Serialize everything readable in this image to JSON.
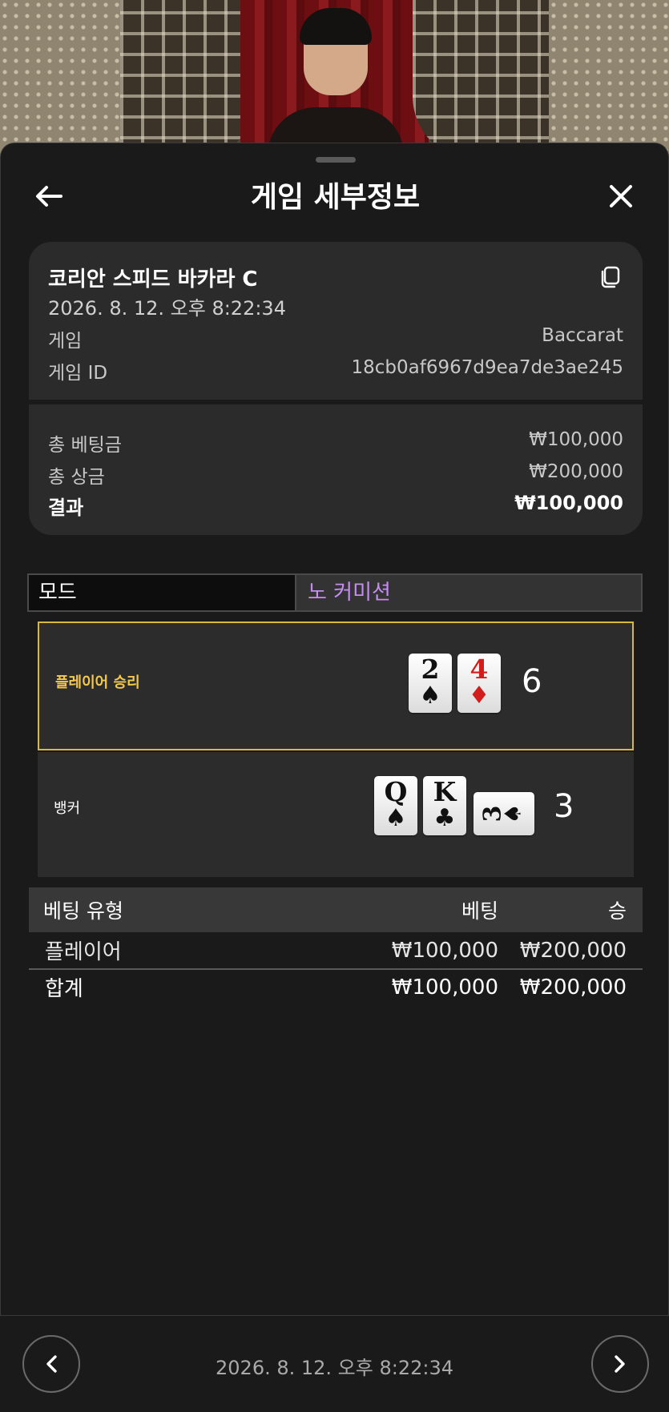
{
  "header": {
    "title": "게임 세부정보"
  },
  "game": {
    "table_name": "코리안 스피드 바카라 C",
    "datetime": "2026. 8. 12. 오후 8:22:34",
    "game_label": "게임",
    "game_value": "Baccarat",
    "id_label": "게임 ID",
    "id_value": "18cb0af6967d9ea7de3ae245"
  },
  "totals": {
    "bet_label": "총 베팅금",
    "bet_value": "₩100,000",
    "win_label": "총 상금",
    "win_value": "₩200,000",
    "result_label": "결과",
    "result_value": "₩100,000"
  },
  "mode": {
    "label": "모드",
    "value": "노 커미션"
  },
  "player": {
    "label": "플레이어 승리",
    "score": "6",
    "cards": [
      {
        "rank": "2",
        "suit": "♠"
      },
      {
        "rank": "4",
        "suit": "♦"
      }
    ]
  },
  "banker": {
    "label": "뱅커",
    "score": "3",
    "cards": [
      {
        "rank": "Q",
        "suit": "♠"
      },
      {
        "rank": "K",
        "suit": "♣"
      },
      {
        "rank": "3",
        "suit": "♠"
      }
    ]
  },
  "bets": {
    "headers": [
      "베팅 유형",
      "베팅",
      "승"
    ],
    "rows": [
      {
        "type": "플레이어",
        "bet": "₩100,000",
        "win": "₩200,000"
      }
    ],
    "total": {
      "type": "합계",
      "bet": "₩100,000",
      "win": "₩200,000"
    }
  },
  "footer": {
    "datetime": "2026. 8. 12. 오후 8:22:34"
  },
  "colors": {
    "accent_winner": "#d9b83a",
    "mode_value": "#c58df2",
    "red_suit": "#d21d1d"
  },
  "icons": [
    "back-arrow-icon",
    "close-icon",
    "copy-icon",
    "chevron-left-icon",
    "chevron-right-icon"
  ]
}
